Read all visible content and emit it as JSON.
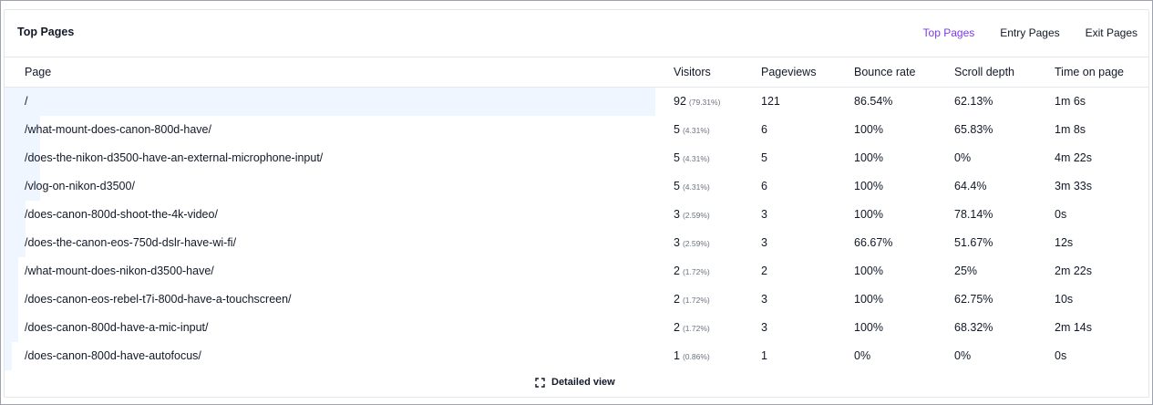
{
  "panel": {
    "title": "Top Pages",
    "tabs": [
      {
        "label": "Top Pages",
        "active": true
      },
      {
        "label": "Entry Pages",
        "active": false
      },
      {
        "label": "Exit Pages",
        "active": false
      }
    ]
  },
  "table": {
    "columns": [
      "Page",
      "Visitors",
      "Pageviews",
      "Bounce rate",
      "Scroll depth",
      "Time on page"
    ],
    "rows": [
      {
        "page": "/",
        "visitors": "92",
        "pct": "(79.31%)",
        "share": 0.7931,
        "pageviews": "121",
        "bounce": "86.54%",
        "scroll": "62.13%",
        "time": "1m 6s"
      },
      {
        "page": "/what-mount-does-canon-800d-have/",
        "visitors": "5",
        "pct": "(4.31%)",
        "share": 0.0431,
        "pageviews": "6",
        "bounce": "100%",
        "scroll": "65.83%",
        "time": "1m 8s"
      },
      {
        "page": "/does-the-nikon-d3500-have-an-external-microphone-input/",
        "visitors": "5",
        "pct": "(4.31%)",
        "share": 0.0431,
        "pageviews": "5",
        "bounce": "100%",
        "scroll": "0%",
        "time": "4m 22s"
      },
      {
        "page": "/vlog-on-nikon-d3500/",
        "visitors": "5",
        "pct": "(4.31%)",
        "share": 0.0431,
        "pageviews": "6",
        "bounce": "100%",
        "scroll": "64.4%",
        "time": "3m 33s"
      },
      {
        "page": "/does-canon-800d-shoot-the-4k-video/",
        "visitors": "3",
        "pct": "(2.59%)",
        "share": 0.0259,
        "pageviews": "3",
        "bounce": "100%",
        "scroll": "78.14%",
        "time": "0s"
      },
      {
        "page": "/does-the-canon-eos-750d-dslr-have-wi-fi/",
        "visitors": "3",
        "pct": "(2.59%)",
        "share": 0.0259,
        "pageviews": "3",
        "bounce": "66.67%",
        "scroll": "51.67%",
        "time": "12s"
      },
      {
        "page": "/what-mount-does-nikon-d3500-have/",
        "visitors": "2",
        "pct": "(1.72%)",
        "share": 0.0172,
        "pageviews": "2",
        "bounce": "100%",
        "scroll": "25%",
        "time": "2m 22s"
      },
      {
        "page": "/does-canon-eos-rebel-t7i-800d-have-a-touchscreen/",
        "visitors": "2",
        "pct": "(1.72%)",
        "share": 0.0172,
        "pageviews": "3",
        "bounce": "100%",
        "scroll": "62.75%",
        "time": "10s"
      },
      {
        "page": "/does-canon-800d-have-a-mic-input/",
        "visitors": "2",
        "pct": "(1.72%)",
        "share": 0.0172,
        "pageviews": "3",
        "bounce": "100%",
        "scroll": "68.32%",
        "time": "2m 14s"
      },
      {
        "page": "/does-canon-800d-have-autofocus/",
        "visitors": "1",
        "pct": "(0.86%)",
        "share": 0.0086,
        "pageviews": "1",
        "bounce": "0%",
        "scroll": "0%",
        "time": "0s"
      }
    ]
  },
  "footer": {
    "detail_label": "Detailed view",
    "icon": "expand-icon"
  },
  "colors": {
    "accent": "#7c3aed",
    "bar": "#eff6ff"
  }
}
